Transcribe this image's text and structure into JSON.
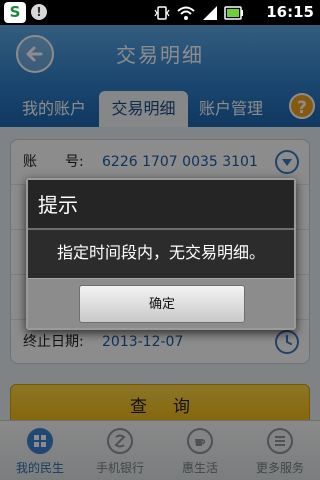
{
  "status_bar": {
    "time": "16:15",
    "icons": [
      "bank-logo-icon",
      "warning-icon",
      "vibrate-icon",
      "wifi-icon",
      "signal-icon",
      "battery-icon"
    ]
  },
  "header": {
    "title": "交易明细"
  },
  "tabs": [
    {
      "label": "我的账户",
      "active": false
    },
    {
      "label": "交易明细",
      "active": true
    },
    {
      "label": "账户管理",
      "active": false
    }
  ],
  "form": {
    "account_label": "账　　号:",
    "account_value": "6226 1707 0035 3101",
    "end_date_label": "终止日期:",
    "end_date_value": "2013-12-07"
  },
  "query_button": "查询",
  "dialog": {
    "title": "提示",
    "message": "指定时间段内，无交易明细。",
    "ok_label": "确定"
  },
  "bottom_nav": [
    {
      "label": "我的民生",
      "icon": "grid-icon",
      "active": true
    },
    {
      "label": "手机银行",
      "icon": "bank-logo-icon",
      "active": false
    },
    {
      "label": "惠生活",
      "icon": "coffee-cup-icon",
      "active": false
    },
    {
      "label": "更多服务",
      "icon": "menu-lines-icon",
      "active": false
    }
  ],
  "colors": {
    "header_blue": "#3a8ad6",
    "accent_yellow": "#f6c21f",
    "dialog_bg": "#2a2a2a",
    "active_nav": "#3b83d1"
  }
}
